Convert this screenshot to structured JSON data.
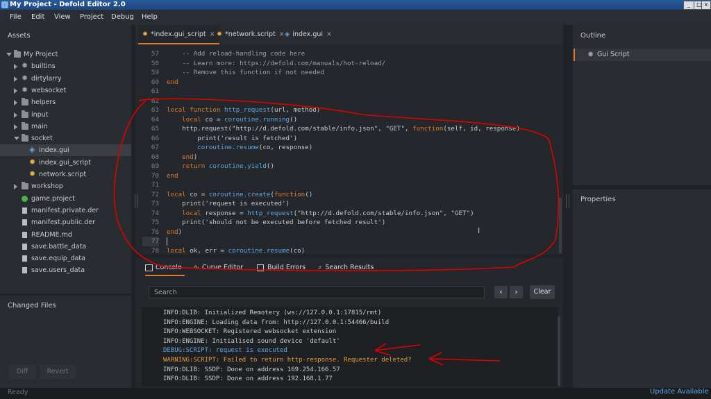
{
  "window": {
    "title": "My Project - Defold Editor 2.0",
    "minimize": "_",
    "maximize": "□",
    "close": "×"
  },
  "menu": [
    "File",
    "Edit",
    "View",
    "Project",
    "Debug",
    "Help"
  ],
  "assets": {
    "title": "Assets",
    "tree": [
      {
        "label": "My Project",
        "icon": "folder",
        "depth": 0,
        "arrow": "down"
      },
      {
        "label": "builtins",
        "icon": "gear",
        "depth": 1,
        "arrow": "right"
      },
      {
        "label": "dirtylarry",
        "icon": "gear",
        "depth": 1,
        "arrow": "right"
      },
      {
        "label": "websocket",
        "icon": "gear",
        "depth": 1,
        "arrow": "right"
      },
      {
        "label": "helpers",
        "icon": "folder",
        "depth": 1,
        "arrow": "right"
      },
      {
        "label": "input",
        "icon": "folder",
        "depth": 1,
        "arrow": "right"
      },
      {
        "label": "main",
        "icon": "folder",
        "depth": 1,
        "arrow": "right"
      },
      {
        "label": "socket",
        "icon": "folder",
        "depth": 1,
        "arrow": "down"
      },
      {
        "label": "index.gui",
        "icon": "gui",
        "depth": 2,
        "selected": true
      },
      {
        "label": "index.gui_script",
        "icon": "script",
        "depth": 2
      },
      {
        "label": "network.script",
        "icon": "script",
        "depth": 2
      },
      {
        "label": "workshop",
        "icon": "folder",
        "depth": 1,
        "arrow": "right"
      },
      {
        "label": "game.project",
        "icon": "project",
        "depth": 1
      },
      {
        "label": "manifest.private.der",
        "icon": "file",
        "depth": 1
      },
      {
        "label": "manifest.public.der",
        "icon": "file",
        "depth": 1
      },
      {
        "label": "README.md",
        "icon": "file",
        "depth": 1
      },
      {
        "label": "save.battle_data",
        "icon": "file",
        "depth": 1
      },
      {
        "label": "save.equip_data",
        "icon": "file",
        "depth": 1
      },
      {
        "label": "save.users_data",
        "icon": "file",
        "depth": 1
      }
    ]
  },
  "changed_files": {
    "title": "Changed Files",
    "diff": "Diff",
    "revert": "Revert"
  },
  "tabs": [
    {
      "label": "*index.gui_script",
      "icon": "script",
      "active": true
    },
    {
      "label": "*network.script",
      "icon": "script"
    },
    {
      "label": "index.gui",
      "icon": "gui"
    }
  ],
  "code": [
    {
      "n": "57",
      "t": "    -- Add reload-handling code here"
    },
    {
      "n": "58",
      "t": "    -- Learn more: https://defold.com/manuals/hot-reload/"
    },
    {
      "n": "59",
      "t": "    -- Remove this function if not needed"
    },
    {
      "n": "60",
      "t": "end"
    },
    {
      "n": "61",
      "t": ""
    },
    {
      "n": "62",
      "t": ""
    },
    {
      "n": "63",
      "t": "local function http_request(url, method)"
    },
    {
      "n": "64",
      "t": "    local co = coroutine.running()"
    },
    {
      "n": "65",
      "t": "    http.request(\"http://d.defold.com/stable/info.json\", \"GET\", function(self, id, response)"
    },
    {
      "n": "66",
      "t": "        print('result is fetched')"
    },
    {
      "n": "67",
      "t": "        coroutine.resume(co, response)"
    },
    {
      "n": "68",
      "t": "    end)"
    },
    {
      "n": "69",
      "t": "    return coroutine.yield()"
    },
    {
      "n": "70",
      "t": "end"
    },
    {
      "n": "71",
      "t": ""
    },
    {
      "n": "72",
      "t": "local co = coroutine.create(function()"
    },
    {
      "n": "73",
      "t": "    print('request is executed')"
    },
    {
      "n": "74",
      "t": "    local response = http_request(\"http://d.defold.com/stable/info.json\", \"GET\")"
    },
    {
      "n": "75",
      "t": "    print('should not be executed before fetched result')"
    },
    {
      "n": "76",
      "t": "end)"
    },
    {
      "n": "77",
      "t": ""
    },
    {
      "n": "78",
      "t": "local ok, err = coroutine.resume(co)"
    }
  ],
  "bottom_tabs": [
    "Console",
    "Curve Editor",
    "Build Errors",
    "Search Results"
  ],
  "console": {
    "search_placeholder": "Search",
    "prev": "‹",
    "next": "›",
    "clear": "Clear",
    "lines": [
      {
        "text": "INFO:DLIB: Initialized Remotery (ws://127.0.0.1:17815/rmt)",
        "level": "info"
      },
      {
        "text": "INFO:ENGINE: Loading data from: http://127.0.0.1:54466/build",
        "level": "info"
      },
      {
        "text": "INFO:WEBSOCKET: Registered websocket extension",
        "level": "info"
      },
      {
        "text": "INFO:ENGINE: Initialised sound device 'default'",
        "level": "info"
      },
      {
        "text": "DEBUG:SCRIPT: request is executed",
        "level": "debug"
      },
      {
        "text": "WARNING:SCRIPT: Failed to return http-response. Requester deleted?",
        "level": "warning"
      },
      {
        "text": "INFO:DLIB: SSDP: Done on address 169.254.166.57",
        "level": "info"
      },
      {
        "text": "INFO:DLIB: SSDP: Done on address 192.168.1.77",
        "level": "info"
      }
    ]
  },
  "outline": {
    "title": "Outline",
    "item": "Gui Script"
  },
  "properties": {
    "title": "Properties"
  },
  "status": {
    "left": "Ready",
    "right": "Update Available"
  },
  "colors": {
    "accent": "#e07a2c",
    "debug": "#5fa6e6",
    "warning": "#e2a03c",
    "annotation": "#e00000",
    "link": "#5fa6e6"
  }
}
